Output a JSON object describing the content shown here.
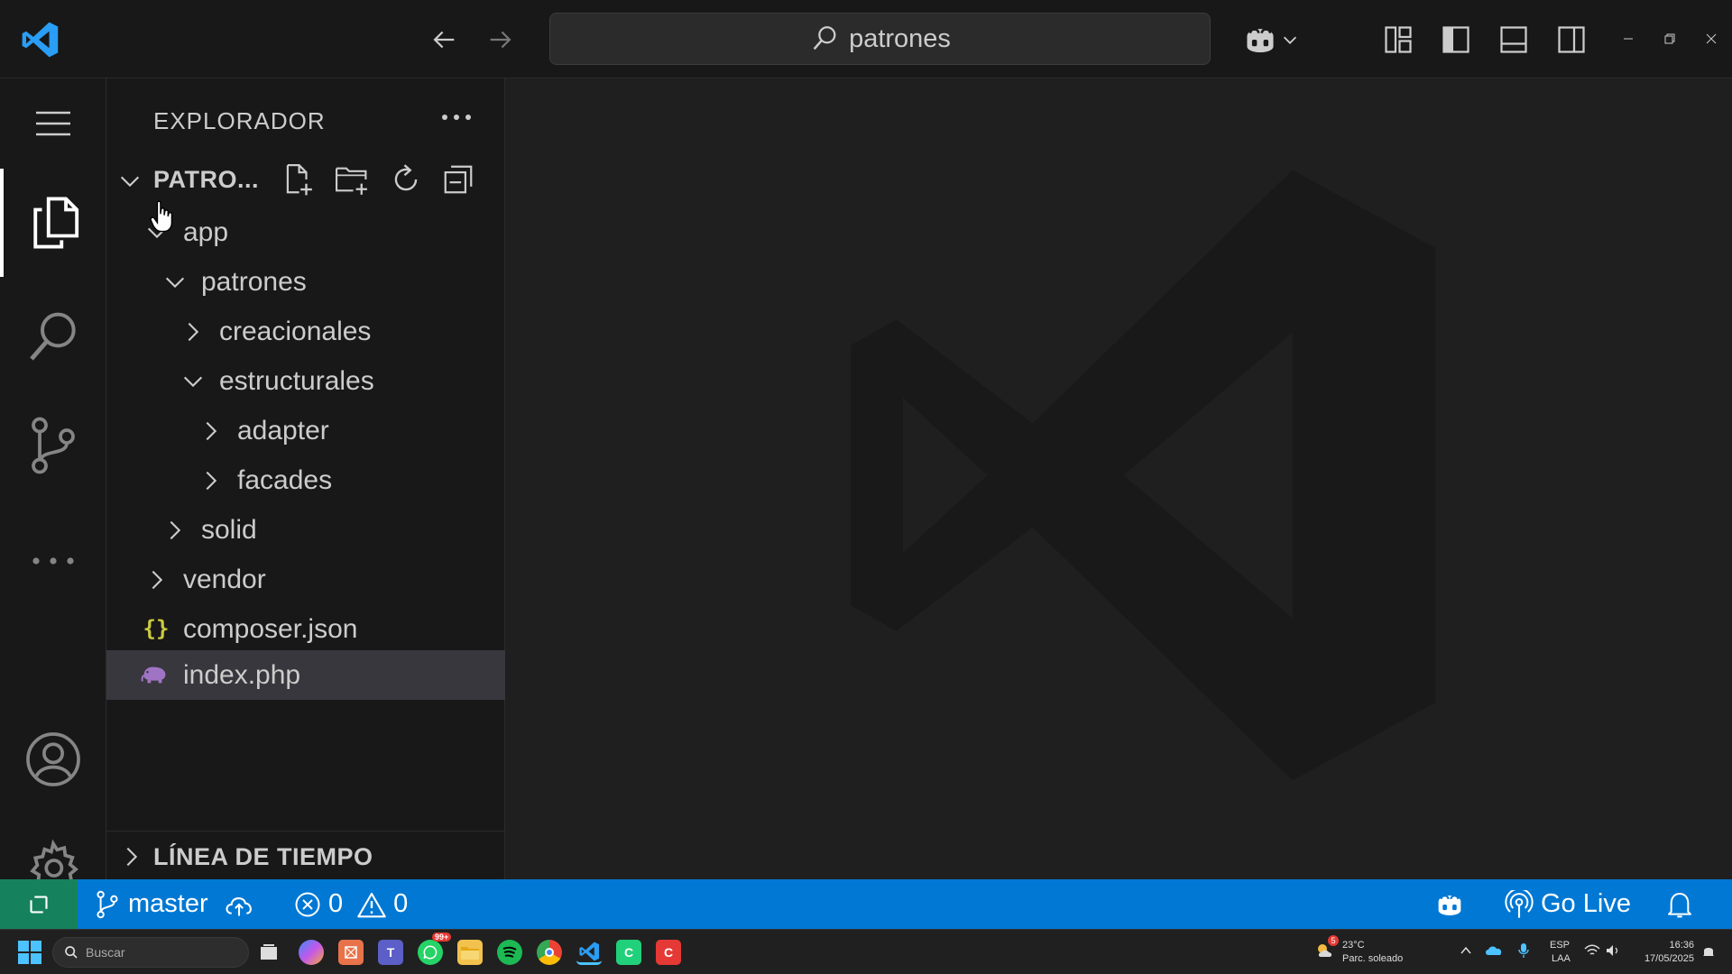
{
  "titlebar": {
    "search_text": "patrones"
  },
  "activity": {
    "items": [
      "explorer",
      "search",
      "source-control",
      "more"
    ],
    "bottom": [
      "accounts",
      "manage"
    ]
  },
  "sidebar": {
    "title": "EXPLORADOR",
    "folder_name": "PATRO...",
    "tree": [
      {
        "label": "app",
        "depth": 0,
        "type": "folder",
        "expanded": true
      },
      {
        "label": "patrones",
        "depth": 1,
        "type": "folder",
        "expanded": true
      },
      {
        "label": "creacionales",
        "depth": 2,
        "type": "folder",
        "expanded": false
      },
      {
        "label": "estructurales",
        "depth": 2,
        "type": "folder",
        "expanded": true
      },
      {
        "label": "adapter",
        "depth": 3,
        "type": "folder",
        "expanded": false
      },
      {
        "label": "facades",
        "depth": 3,
        "type": "folder",
        "expanded": false
      },
      {
        "label": "solid",
        "depth": 1,
        "type": "folder",
        "expanded": false
      },
      {
        "label": "vendor",
        "depth": 0,
        "type": "folder",
        "expanded": false
      },
      {
        "label": "composer.json",
        "depth": 0,
        "type": "json"
      },
      {
        "label": "index.php",
        "depth": 0,
        "type": "php",
        "selected": true
      }
    ],
    "timeline_title": "LÍNEA DE TIEMPO"
  },
  "statusbar": {
    "branch": "master",
    "errors": "0",
    "warnings": "0",
    "go_live": "Go Live"
  },
  "taskbar": {
    "search_placeholder": "Buscar",
    "badge": "99+",
    "weather_temp": "23°C",
    "weather_desc": "Parc. soleado",
    "weather_badge": "5",
    "lang_1": "ESP",
    "lang_2": "LAA",
    "time": "16:36",
    "date": "17/05/2025"
  },
  "colors": {
    "accent": "#0078d4",
    "remote": "#16825d",
    "json_icon": "#cbcb41",
    "php_icon": "#a074c4"
  }
}
